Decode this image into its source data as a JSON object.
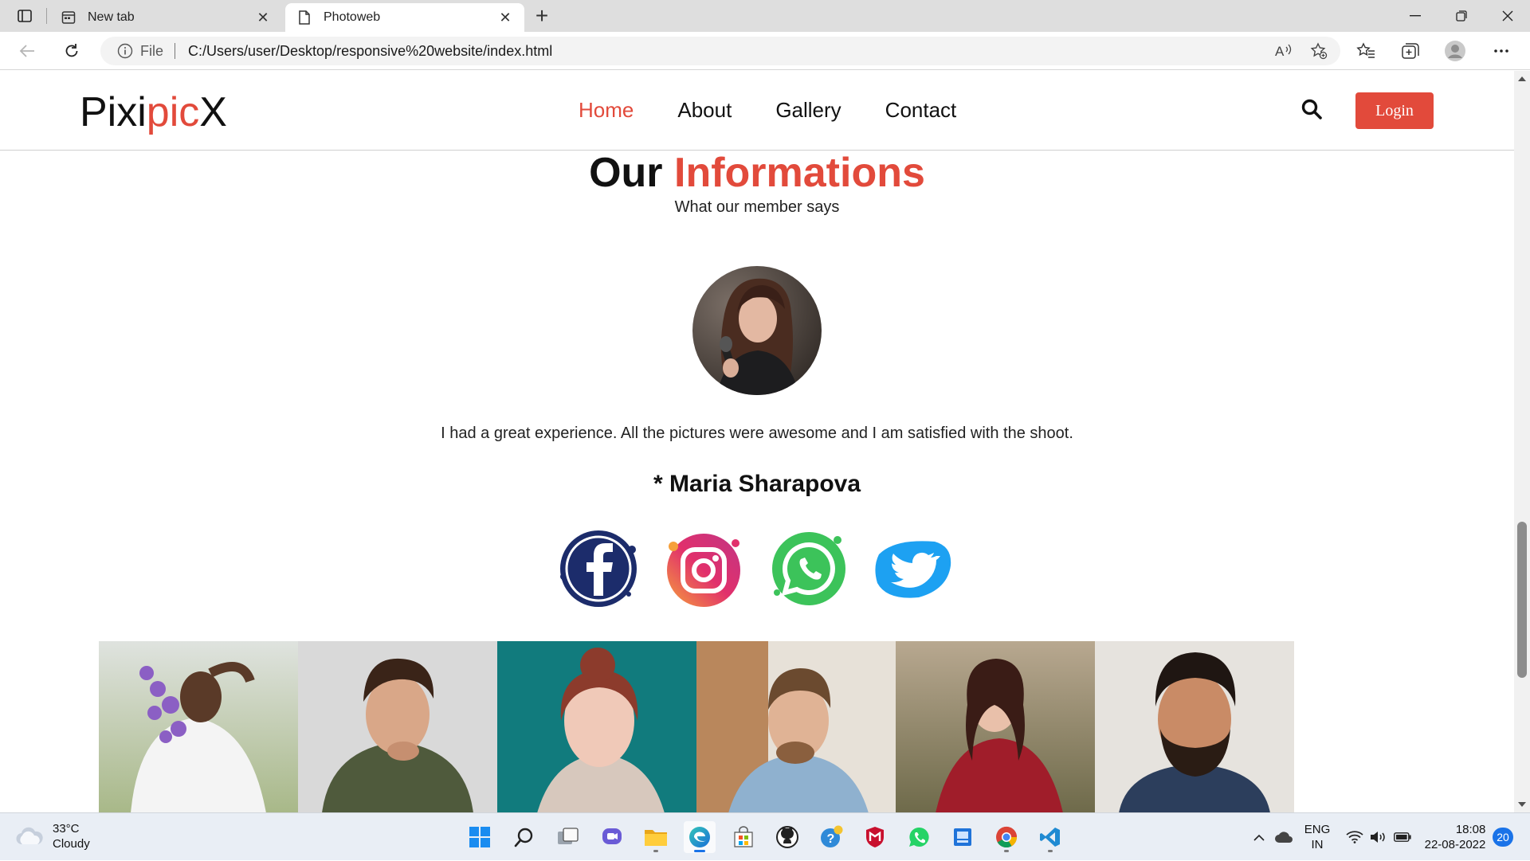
{
  "browser": {
    "tabs": [
      {
        "title": "New tab",
        "active": false
      },
      {
        "title": "Photoweb",
        "active": true
      }
    ],
    "omnibox": {
      "scheme_label": "File",
      "url": "C:/Users/user/Desktop/responsive%20website/index.html"
    }
  },
  "site": {
    "logo": {
      "part1": "Pixi",
      "part2": "pic",
      "part3": "X"
    },
    "nav": [
      {
        "label": "Home",
        "active": true
      },
      {
        "label": "About",
        "active": false
      },
      {
        "label": "Gallery",
        "active": false
      },
      {
        "label": "Contact",
        "active": false
      }
    ],
    "login_label": "Login",
    "section": {
      "title_part1": "Our",
      "title_part2": "Informations",
      "subtitle": "What our member says"
    },
    "testimonial": {
      "quote": "I had a great experience. All the pictures were awesome and I am satisfied with the shoot.",
      "author": "* Maria Sharapova"
    },
    "socials": [
      "facebook-icon",
      "instagram-icon",
      "whatsapp-icon",
      "twitter-icon"
    ],
    "colors": {
      "accent": "#e24a3b"
    }
  },
  "taskbar": {
    "weather": {
      "temp": "33°C",
      "condition": "Cloudy"
    },
    "lang": {
      "line1": "ENG",
      "line2": "IN"
    },
    "clock": {
      "time": "18:08",
      "date": "22-08-2022"
    },
    "notifications": "20"
  }
}
